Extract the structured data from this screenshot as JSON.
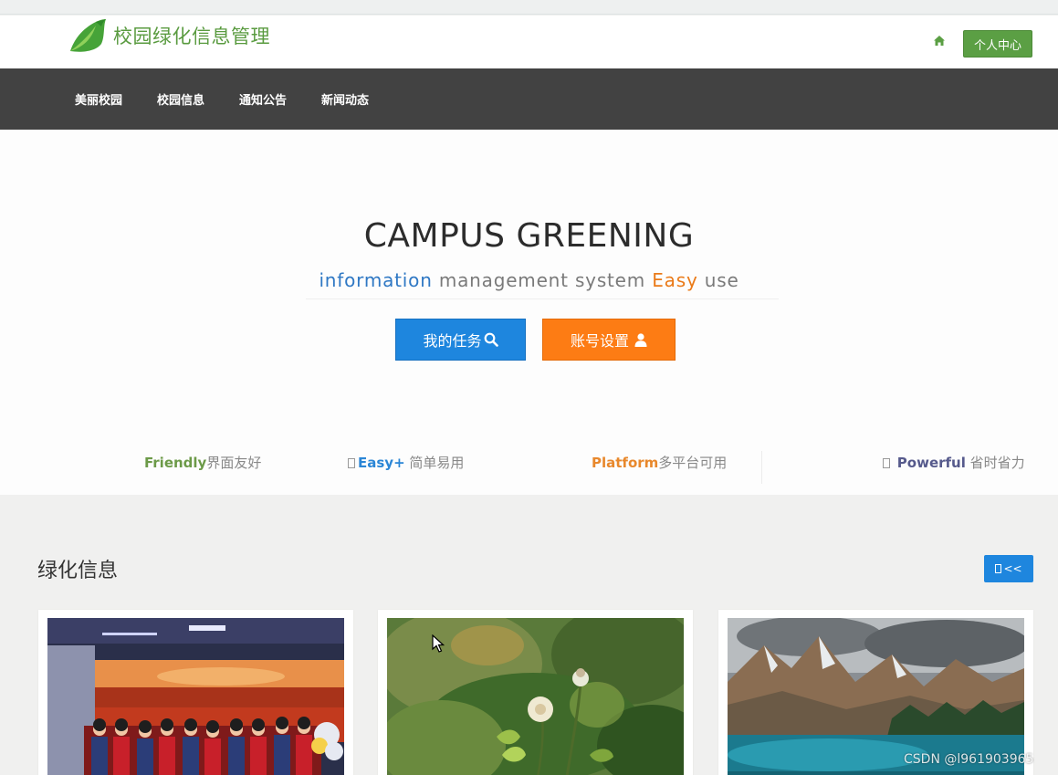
{
  "header": {
    "site_title": "校园绿化信息管理",
    "home_icon": "home-icon",
    "user_center_label": "个人中心",
    "brand_color": "#5b9f44"
  },
  "nav": {
    "items": [
      {
        "label": "美丽校园"
      },
      {
        "label": "校园信息"
      },
      {
        "label": "通知公告"
      },
      {
        "label": "新闻动态"
      }
    ]
  },
  "hero": {
    "title": "CAMPUS GREENING",
    "subtitle": {
      "part1": "information",
      "part2": " management system ",
      "part3": "Easy",
      "part4": " use"
    },
    "task_button": "我的任务",
    "task_icon": "search-icon",
    "account_button": "账号设置",
    "account_icon": "user-icon"
  },
  "features": [
    {
      "bold": "Friendly",
      "text": "界面友好"
    },
    {
      "bold": "Easy+",
      "text": " 简单易用"
    },
    {
      "bold": "Platform",
      "text": "多平台可用"
    },
    {
      "bold": "Powerful",
      "text": " 省时省力"
    }
  ],
  "section": {
    "title": "绿化信息",
    "back_button": "<<"
  },
  "cards": [
    {
      "image": "children-choir-on-stage"
    },
    {
      "image": "dandelion-flower-closeup"
    },
    {
      "image": "mountain-lake-landscape"
    }
  ],
  "watermark": "CSDN @l961903965",
  "colors": {
    "accent_blue": "#1e86de",
    "accent_orange": "#fd7c14",
    "nav_bg": "#424242"
  }
}
